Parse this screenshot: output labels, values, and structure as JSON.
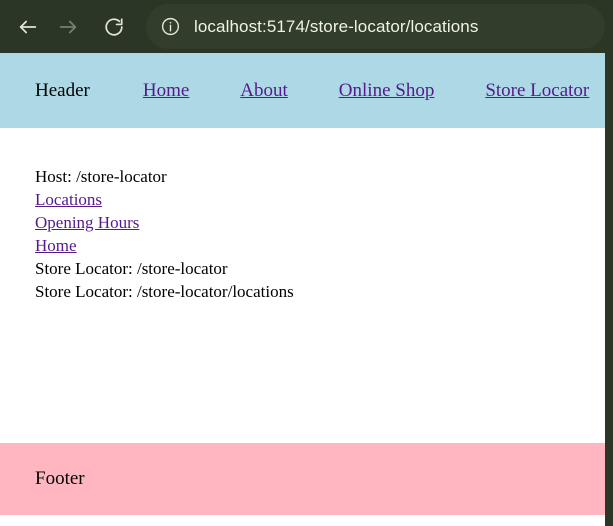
{
  "browser": {
    "back_label": "Back",
    "forward_label": "Forward",
    "reload_label": "Reload",
    "site_info_label": "View site information",
    "url": "localhost:5174/store-locator/locations",
    "toolbar_color": "#2b3626",
    "urlbar_color": "#323d2c",
    "url_text_color": "#eef3e6"
  },
  "page": {
    "header": {
      "title": "Header",
      "background": "#add8e6",
      "nav": [
        {
          "label": "Home"
        },
        {
          "label": "About"
        },
        {
          "label": "Online Shop"
        },
        {
          "label": "Store Locator"
        }
      ]
    },
    "main": {
      "lines": [
        {
          "type": "text",
          "text": "Host: /store-locator"
        },
        {
          "type": "link",
          "text": "Locations"
        },
        {
          "type": "link",
          "text": "Opening Hours"
        },
        {
          "type": "link",
          "text": "Home"
        },
        {
          "type": "text",
          "text": "Store Locator: /store-locator"
        },
        {
          "type": "text",
          "text": "Store Locator: /store-locator/locations"
        }
      ]
    },
    "footer": {
      "title": "Footer",
      "background": "#ffb6c1"
    },
    "link_color": "#551a8b"
  }
}
